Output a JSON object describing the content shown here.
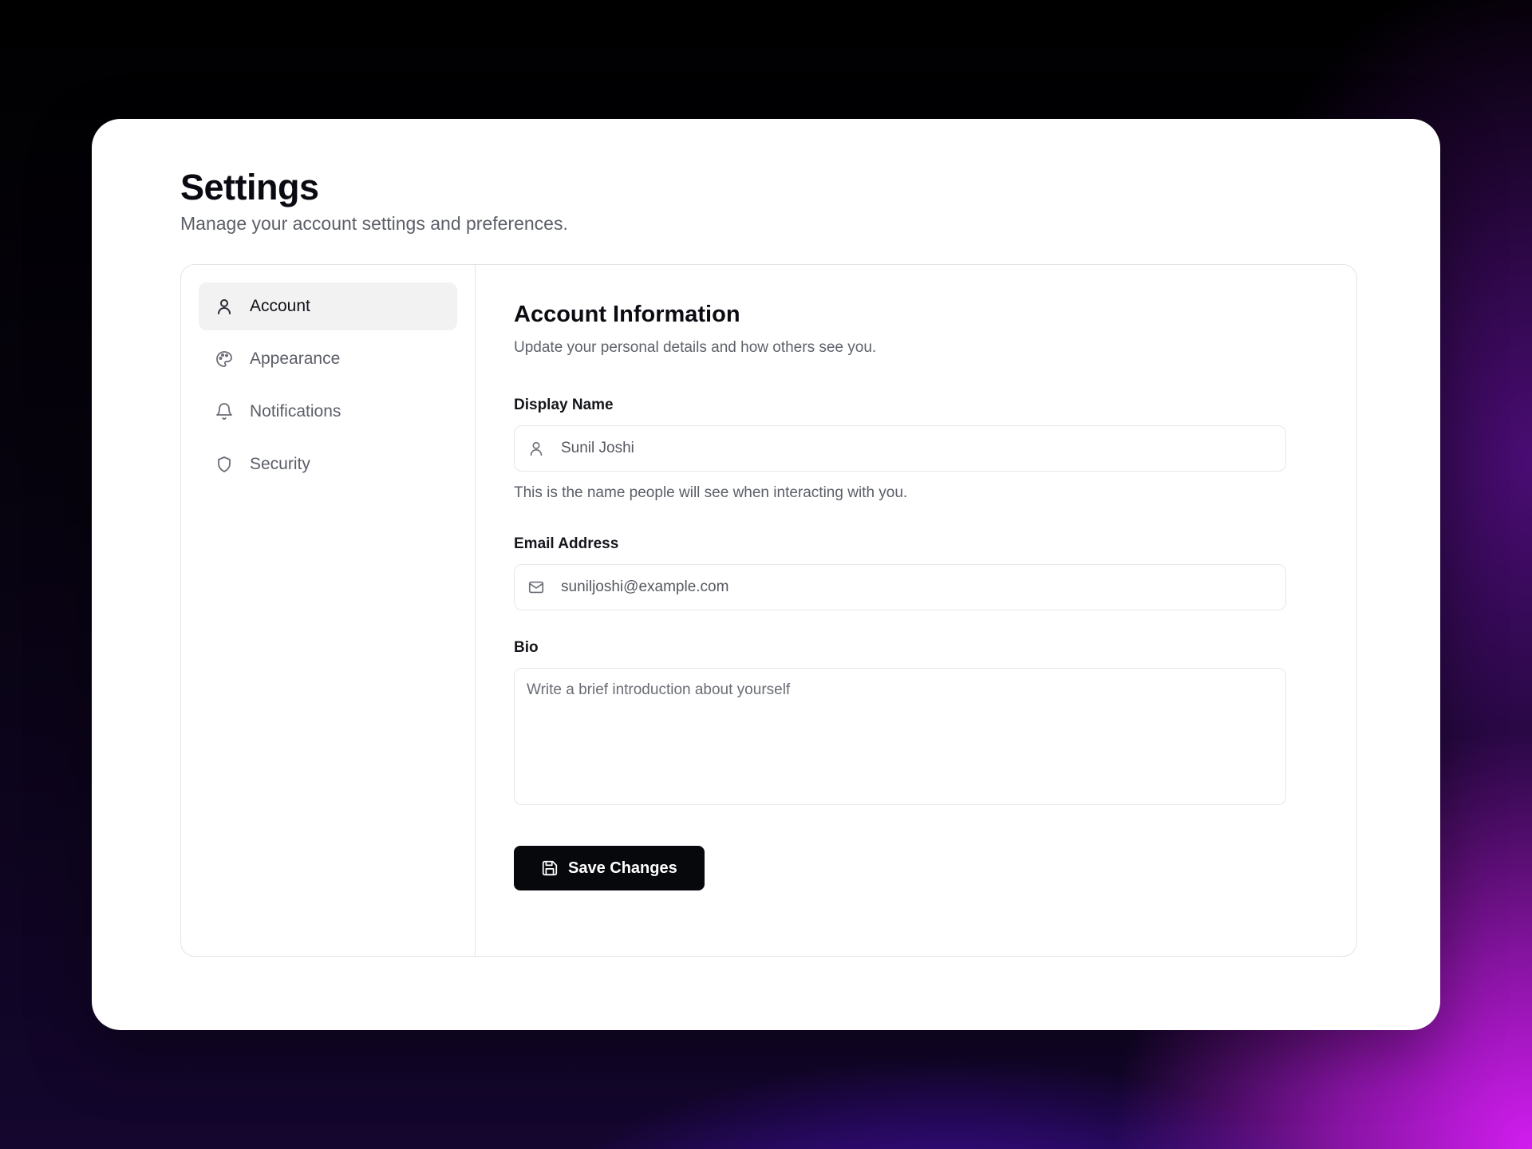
{
  "header": {
    "title": "Settings",
    "subtitle": "Manage your account settings and preferences."
  },
  "sidebar": {
    "items": [
      {
        "label": "Account",
        "icon": "user-icon",
        "active": true
      },
      {
        "label": "Appearance",
        "icon": "palette-icon",
        "active": false
      },
      {
        "label": "Notifications",
        "icon": "bell-icon",
        "active": false
      },
      {
        "label": "Security",
        "icon": "shield-icon",
        "active": false
      }
    ]
  },
  "main": {
    "section_title": "Account Information",
    "section_subtitle": "Update your personal details and how others see you.",
    "display_name": {
      "label": "Display Name",
      "value": "Sunil Joshi",
      "icon": "user-icon",
      "help": "This is the name people will see when interacting with you."
    },
    "email": {
      "label": "Email Address",
      "value": "suniljoshi@example.com",
      "icon": "mail-icon"
    },
    "bio": {
      "label": "Bio",
      "placeholder": "Write a brief introduction about yourself"
    },
    "save_button": {
      "label": "Save Changes",
      "icon": "save-icon"
    }
  },
  "colors": {
    "button_bg": "#07080c",
    "active_item_bg": "#f2f2f3",
    "background_purple": "#5a10e0",
    "background_magenta": "#d21df0"
  }
}
